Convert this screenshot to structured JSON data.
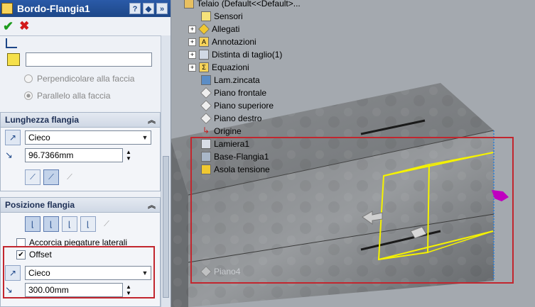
{
  "panel": {
    "title": "Bordo-Flangia1",
    "help_icon": "?",
    "tool_icon": "◆",
    "pin_icon": "»",
    "ok_icon": "✔",
    "cancel_icon": "✖",
    "face_field": "",
    "radio_perpendicular": "Perpendicolare alla faccia",
    "radio_parallel": "Parallelo alla faccia"
  },
  "lunghezza": {
    "header": "Lunghezza flangia",
    "combo_value": "Cieco",
    "length_value": "96.7366mm"
  },
  "posizione": {
    "header": "Posizione flangia",
    "chk_accorcia": "Accorcia piegature laterali",
    "chk_offset": "Offset",
    "offset_combo": "Cieco",
    "offset_value": "300.00mm"
  },
  "tree": {
    "root": "Telaio  (Default<<Default>...",
    "items": [
      "Sensori",
      "Allegati",
      "Annotazioni",
      "Distinta di taglio(1)",
      "Equazioni",
      "Lam.zincata",
      "Piano frontale",
      "Piano superiore",
      "Piano destro",
      "Origine",
      "Lamiera1",
      "Base-Flangia1",
      "Asola tensione",
      "Piano4"
    ]
  },
  "colors": {
    "accent": "#1d4788",
    "highlight": "#c2262e",
    "edge": "#f5f200",
    "handle": "#c000c0"
  }
}
